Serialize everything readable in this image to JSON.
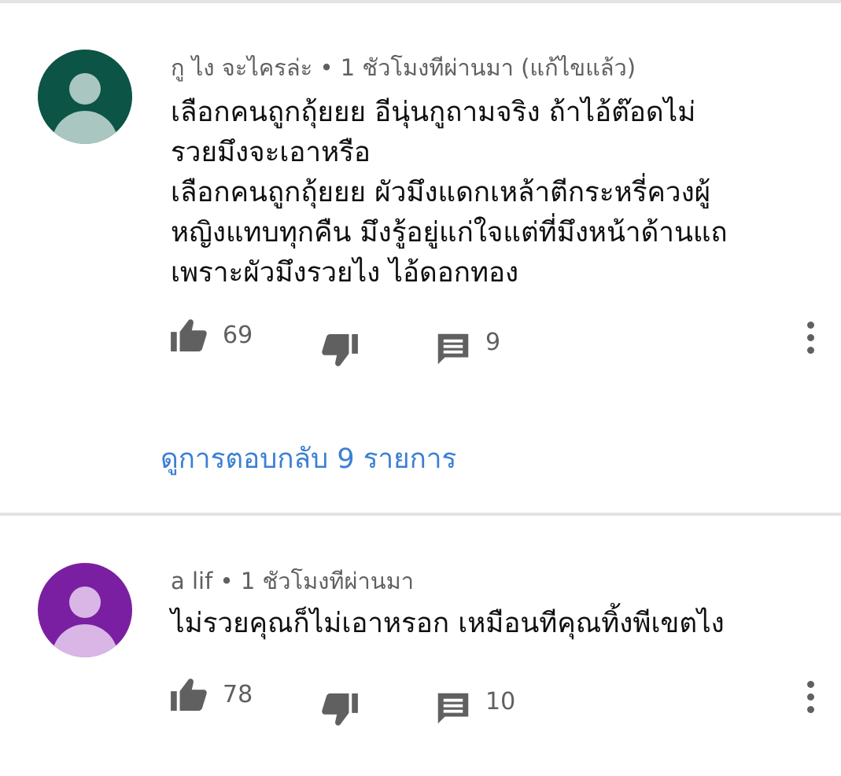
{
  "comments": [
    {
      "author": "กู ไง จะไครล่ะ",
      "time": "1 ชัวโมงทีผ่านมา (แก้ไขแล้ว)",
      "avatar_color": "#0b5446",
      "avatar_figure_color": "#a9c6c0",
      "text": "เลือกคนถูกถุ้ยยย อีนุ่นกูถามจริง ถ้าไอ้ต๊อดไม่\nรวยมึงจะเอาหรือ\nเลือกคนถูกถุ้ยยย ผัวมึงแดกเหล้าตีกระหรี่ควงผู้\nหญิงแทบทุกคืน มึงรู้อยู่แก่ใจแต่ที่มึงหน้าด้านแถ\nเพราะผัวมึงรวยไง ไอ้ดอกทอง",
      "likes": "69",
      "reply_count": "9",
      "view_replies": "ดูการตอบกลับ 9 รายการ"
    },
    {
      "author": "a lif",
      "time": "1 ชัวโมงทีผ่านมา",
      "avatar_color": "#7b1fa2",
      "avatar_figure_color": "#d9b6e6",
      "text": "ไม่รวยคุณก็ไม่เอาหรอก เหมือนทีคุณทิ้งพีเขตไง",
      "likes": "78",
      "reply_count": "10"
    }
  ],
  "separator": "•",
  "icons": [
    "thumb-up-icon",
    "thumb-down-icon",
    "reply-icon",
    "more-vert-icon"
  ],
  "accent_color": "#3b7fd4"
}
